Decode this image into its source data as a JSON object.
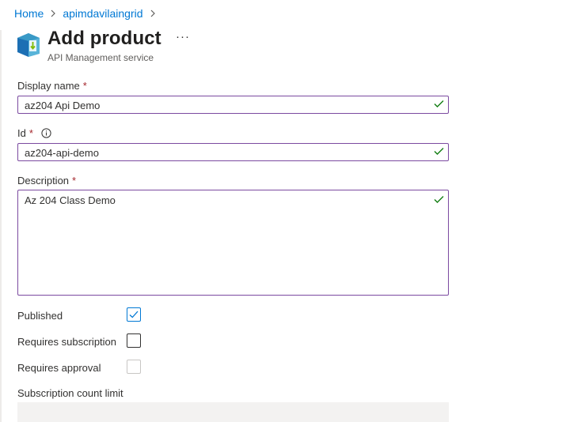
{
  "breadcrumb": {
    "items": [
      "Home",
      "apimdavilaingrid"
    ]
  },
  "header": {
    "title": "Add product",
    "subtitle": "API Management service",
    "more_label": "···",
    "icon": "api-management-icon"
  },
  "form": {
    "display_name": {
      "label": "Display name",
      "required": "*",
      "value": "az204 Api Demo",
      "valid": true
    },
    "id": {
      "label": "Id",
      "required": "*",
      "value": "az204-api-demo",
      "valid": true
    },
    "description": {
      "label": "Description",
      "required": "*",
      "value": "Az 204 Class Demo",
      "valid": true
    },
    "published": {
      "label": "Published",
      "checked": true
    },
    "requires_subscription": {
      "label": "Requires subscription",
      "checked": false
    },
    "requires_approval": {
      "label": "Requires approval",
      "checked": false,
      "disabled": true
    },
    "subscription_count_limit": {
      "label": "Subscription count limit",
      "value": "",
      "disabled": true
    }
  },
  "colors": {
    "accent": "#0078d4",
    "input_border": "#7b4aa0",
    "valid": "#107c10",
    "required": "#a4262c"
  }
}
